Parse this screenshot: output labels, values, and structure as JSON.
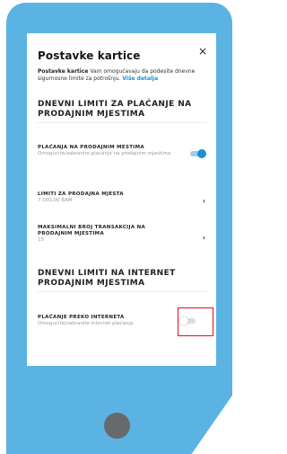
{
  "modal": {
    "title": "Postavke kartice",
    "close_icon": "×",
    "intro_bold": "Postavke kartice",
    "intro_text": " Vam omogućavaju da podesite dnevne sigurnosne limite za potrošnju. ",
    "intro_link": "Više detalja"
  },
  "section_pos": {
    "heading": "DNEVNI LIMITI ZA PLAĆANJE NA PRODAJNIM MJESTIMA",
    "toggle_row": {
      "title": "PLAĆANJA NA PRODAJNIM MESTIMA",
      "subtitle": "Omogućite/zabranite plaćanje na prodajnim mjestima",
      "enabled": true
    },
    "limit_row": {
      "title": "LIMITI ZA PRODAJNA MJESTA",
      "value": "7.000,00 BAM"
    },
    "max_tx_row": {
      "title": "MAKSIMALNI BROJ TRANSAKCIJA NA PRODAJNIM MJESTIMA",
      "value": "15"
    },
    "chevron_icon": "›"
  },
  "section_internet": {
    "heading": "DNEVNI LIMITI NA INTERNET PRODAJNIM MJESTIMA",
    "toggle_row": {
      "title": "PLAĆANJE PREKO INTERNETA",
      "subtitle": "Omogućite/zabranite internet plaćanja",
      "enabled": false
    }
  },
  "colors": {
    "phone_body": "#5bb3e3",
    "accent": "#1b8fcf",
    "highlight": "#e0101c",
    "home_button": "#666a6c"
  }
}
